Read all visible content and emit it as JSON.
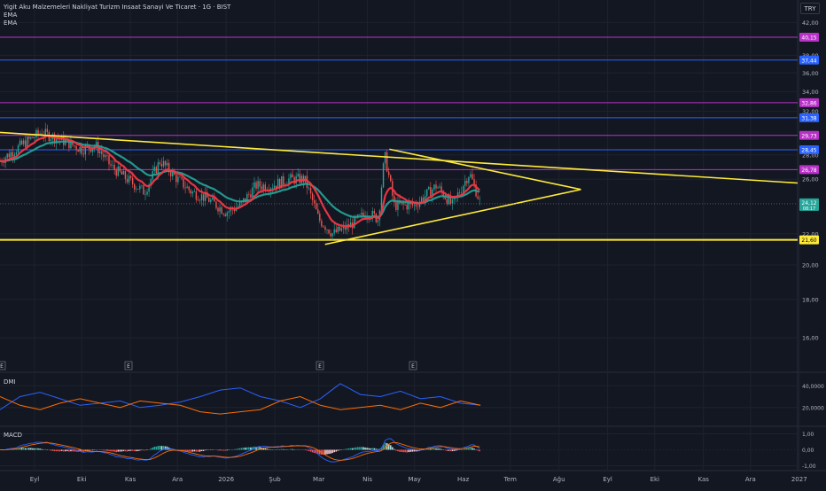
{
  "header": {
    "title": "Yigit Aku Malzemeleri Nakliyat Turizm Insaat Sanayi Ve Ticaret · 1G · BIST",
    "indicators": [
      "EMA",
      "EMA"
    ],
    "currency": "TRY"
  },
  "colors": {
    "background": "#131722",
    "grid": "#1e222d",
    "up": "#26a69a",
    "down": "#ef5350",
    "ema_fast": "#f23645",
    "ema_slow": "#26a69a",
    "trendline": "#ffeb3b",
    "magenta": "#b832c8",
    "blue": "#2962ff",
    "dmi_plus": "#2962ff",
    "dmi_minus": "#ff6d00",
    "macd": "#2962ff",
    "signal": "#ff6d00"
  },
  "x_axis": {
    "labels": [
      "Eyl",
      "Eki",
      "Kas",
      "Ara",
      "2026",
      "Şub",
      "Mar",
      "Nis",
      "May",
      "Haz",
      "Tem",
      "Ağu",
      "Eyl",
      "Eki",
      "Kas",
      "Ara",
      "2027"
    ]
  },
  "chart_data": [
    {
      "type": "candlestick",
      "pane": "price",
      "y_ticks": [
        "42,00",
        "38,00",
        "36,00",
        "34,00",
        "32,00",
        "28,00",
        "26,00",
        "22,00",
        "20,00",
        "18,00",
        "16,00"
      ],
      "ylim": [
        15.0,
        45.0
      ],
      "scale": "log",
      "horizontal_levels": [
        {
          "value": 40.15,
          "label": "40,15",
          "color": "#b832c8"
        },
        {
          "value": 37.44,
          "label": "37,44",
          "color": "#2962ff"
        },
        {
          "value": 32.86,
          "label": "32,86",
          "color": "#b832c8"
        },
        {
          "value": 31.38,
          "label": "31,38",
          "color": "#2962ff"
        },
        {
          "value": 29.73,
          "label": "29,73",
          "color": "#b832c8"
        },
        {
          "value": 28.45,
          "label": "28,45",
          "color": "#2962ff"
        },
        {
          "value": 26.78,
          "label": "26,78",
          "color": "#b832c8"
        },
        {
          "value": 21.6,
          "label": "21,60",
          "color": "#ffeb3b"
        }
      ],
      "current_price": {
        "value": 24.12,
        "label": "24,12",
        "countdown": "08:17"
      },
      "trendlines": [
        {
          "x": [
            "2025-08-10",
            "2026-12-31"
          ],
          "y": [
            30.0,
            25.7
          ]
        },
        {
          "x": [
            "2026-04-15",
            "2026-08-15"
          ],
          "y": [
            28.5,
            25.2
          ]
        },
        {
          "x": [
            "2026-03-05",
            "2026-08-15"
          ],
          "y": [
            21.3,
            25.2
          ]
        }
      ],
      "event_markers": [
        "E",
        "E",
        "E",
        "E"
      ],
      "series_close_path": [
        [
          "2025-08-10",
          27.5
        ],
        [
          "2025-08-25",
          29.0
        ],
        [
          "2025-09-05",
          30.0
        ],
        [
          "2025-09-20",
          29.2
        ],
        [
          "2025-10-01",
          28.5
        ],
        [
          "2025-10-10",
          28.8
        ],
        [
          "2025-10-20",
          27.0
        ],
        [
          "2025-10-30",
          26.0
        ],
        [
          "2025-11-10",
          25.0
        ],
        [
          "2025-11-20",
          27.5
        ],
        [
          "2025-12-01",
          26.0
        ],
        [
          "2025-12-10",
          25.0
        ],
        [
          "2025-12-20",
          24.5
        ],
        [
          "2026-01-01",
          23.5
        ],
        [
          "2026-01-10",
          24.0
        ],
        [
          "2026-01-20",
          25.5
        ],
        [
          "2026-01-30",
          25.5
        ],
        [
          "2026-02-10",
          26.0
        ],
        [
          "2026-02-20",
          26.0
        ],
        [
          "2026-03-01",
          23.0
        ],
        [
          "2026-03-10",
          22.0
        ],
        [
          "2026-03-20",
          22.5
        ],
        [
          "2026-04-01",
          23.5
        ],
        [
          "2026-04-08",
          23.0
        ],
        [
          "2026-04-12",
          28.0
        ],
        [
          "2026-04-18",
          24.0
        ],
        [
          "2026-05-01",
          24.0
        ],
        [
          "2026-05-15",
          25.5
        ],
        [
          "2026-05-25",
          24.0
        ],
        [
          "2026-06-05",
          26.5
        ],
        [
          "2026-06-12",
          24.12
        ]
      ]
    },
    {
      "type": "line",
      "pane": "DMI",
      "title": "DMI",
      "y_ticks": [
        "40,0000",
        "20,0000"
      ],
      "series": [
        {
          "color": "#2962ff",
          "values": [
            18,
            30,
            34,
            28,
            22,
            24,
            26,
            20,
            22,
            25,
            30,
            36,
            38,
            30,
            26,
            20,
            28,
            42,
            32,
            30,
            35,
            28,
            30,
            24,
            22
          ]
        },
        {
          "color": "#ff6d00",
          "values": [
            30,
            22,
            18,
            24,
            28,
            24,
            20,
            26,
            24,
            22,
            16,
            14,
            16,
            18,
            26,
            30,
            22,
            18,
            20,
            22,
            18,
            24,
            20,
            26,
            22
          ]
        }
      ]
    },
    {
      "type": "bar",
      "pane": "MACD",
      "title": "MACD",
      "y_ticks": [
        "1,00",
        "0,00",
        "-1,00"
      ]
    }
  ]
}
